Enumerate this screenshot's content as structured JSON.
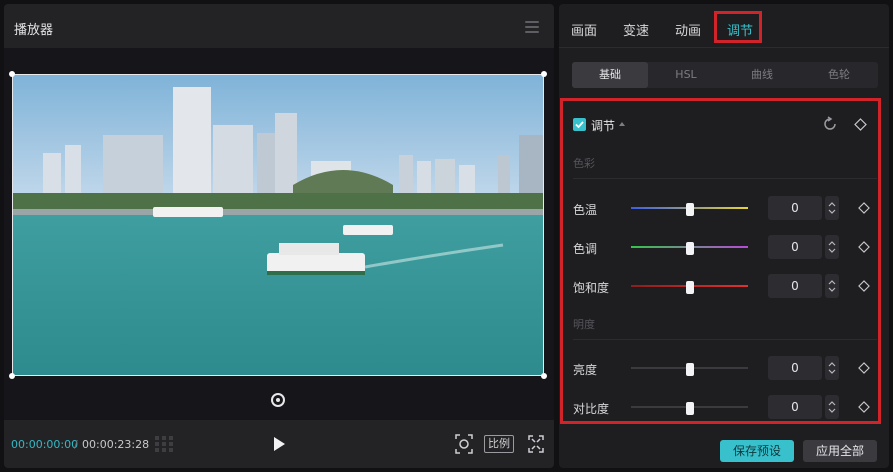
{
  "player": {
    "title": "播放器",
    "time_current": "00:00:00:00",
    "time_separator": "/",
    "time_total": "00:00:23:28",
    "ratio_label": "比例"
  },
  "tabs": [
    {
      "label": "画面",
      "active": false
    },
    {
      "label": "变速",
      "active": false
    },
    {
      "label": "动画",
      "active": false
    },
    {
      "label": "调节",
      "active": true
    }
  ],
  "sub_tabs": [
    {
      "label": "基础",
      "active": true
    },
    {
      "label": "HSL",
      "active": false
    },
    {
      "label": "曲线",
      "active": false
    },
    {
      "label": "色轮",
      "active": false
    }
  ],
  "adjust": {
    "title": "调节",
    "checked": true,
    "sections": [
      {
        "label": "色彩",
        "items": [
          {
            "label": "色温",
            "value": "0",
            "fraction": 0.5
          },
          {
            "label": "色调",
            "value": "0",
            "fraction": 0.5
          },
          {
            "label": "饱和度",
            "value": "0",
            "fraction": 0.5
          }
        ]
      },
      {
        "label": "明度",
        "items": [
          {
            "label": "亮度",
            "value": "0",
            "fraction": 0.5
          },
          {
            "label": "对比度",
            "value": "0",
            "fraction": 0.5
          }
        ]
      }
    ]
  },
  "actions": {
    "save_preset": "保存预设",
    "apply_all": "应用全部"
  },
  "colors": {
    "accent": "#38c1cc",
    "highlight": "#d0242a",
    "temp_gradient": [
      "#3c5ee6",
      "#e8d532"
    ],
    "tint_gradient": [
      "#35c44a",
      "#b84ad8"
    ],
    "saturation_gradient": [
      "#8a1f1f",
      "#e23030"
    ]
  }
}
